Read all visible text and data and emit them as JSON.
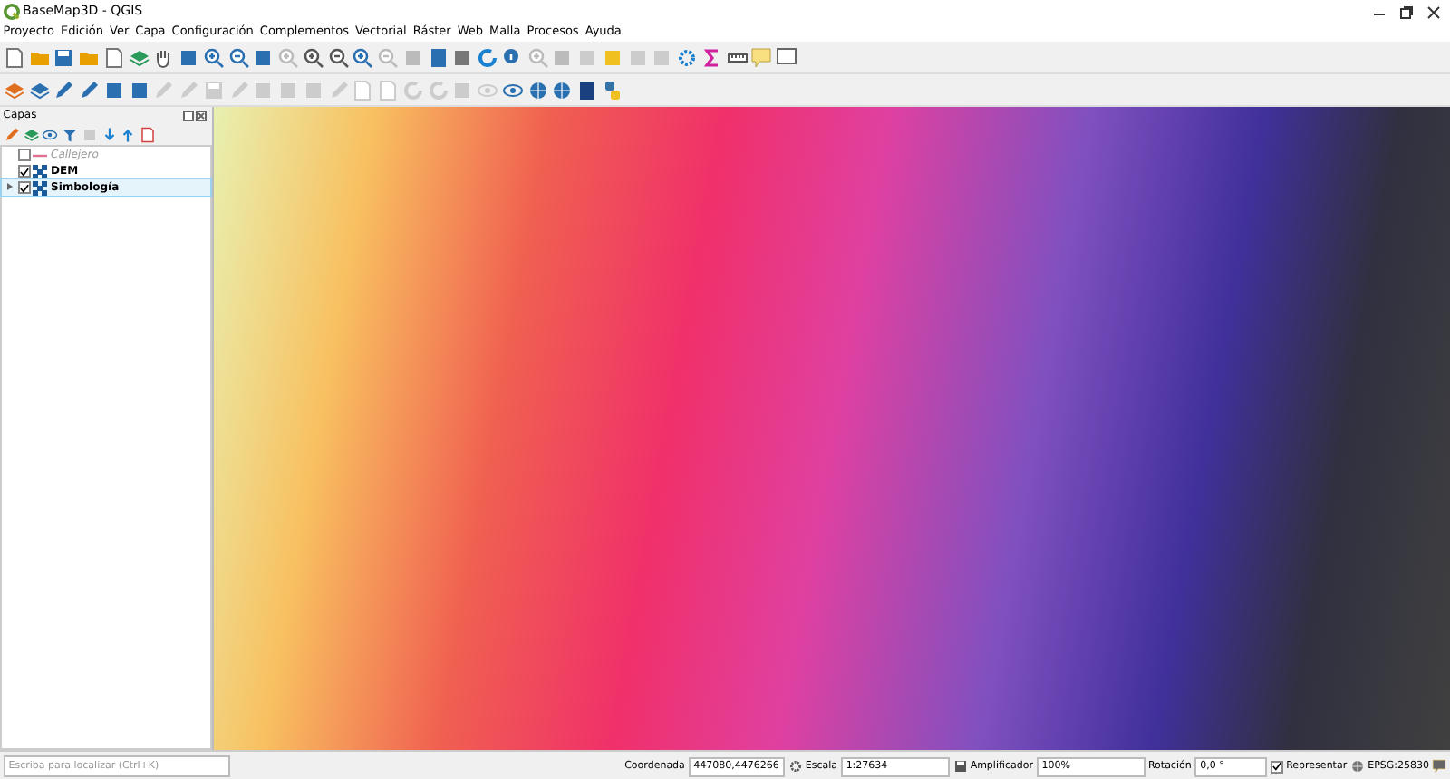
{
  "window": {
    "title": "BaseMap3D - QGIS"
  },
  "menu": [
    "Proyecto",
    "Edición",
    "Ver",
    "Capa",
    "Configuración",
    "Complementos",
    "Vectorial",
    "Ráster",
    "Web",
    "Malla",
    "Procesos",
    "Ayuda"
  ],
  "layers_panel": {
    "title": "Capas",
    "layers": [
      {
        "name": "Callejero",
        "kind": "line",
        "checked": false,
        "selected": false
      },
      {
        "name": "DEM",
        "kind": "raster",
        "checked": true,
        "selected": false
      },
      {
        "name": "Simbología",
        "kind": "raster",
        "checked": true,
        "selected": true,
        "expanded": false
      }
    ]
  },
  "status_bar": {
    "locator_placeholder": "Escriba para localizar (Ctrl+K)",
    "coordinate_label": "Coordenada",
    "coordinate": "447080,4476266",
    "scale_label": "Escala",
    "scale": "1:27634",
    "magnifier_label": "Amplificador",
    "magnifier": "100%",
    "rotation_label": "Rotación",
    "rotation": "0,0 °",
    "render_label": "Representar",
    "render_checked": true,
    "crs": "EPSG:25830"
  }
}
